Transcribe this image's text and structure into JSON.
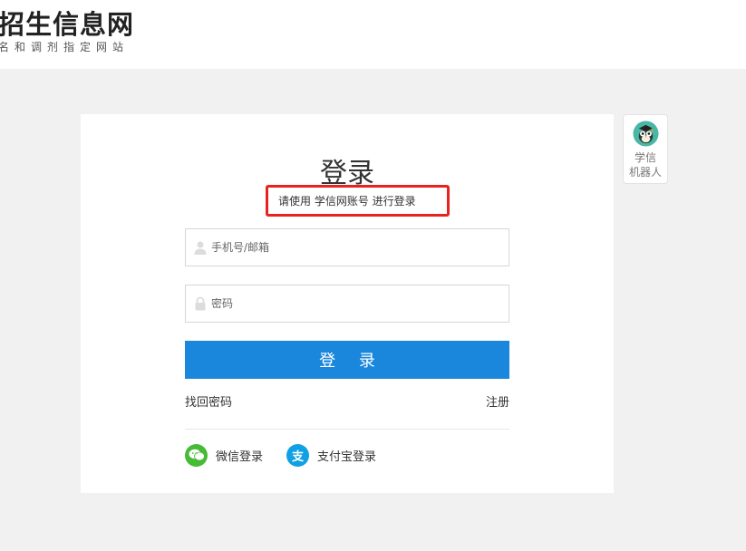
{
  "header": {
    "site_title": "招生信息网",
    "site_subtitle": "名和调剂指定网站"
  },
  "login": {
    "title": "登录",
    "hint": "请使用 学信网账号 进行登录",
    "phone_placeholder": "手机号/邮箱",
    "password_placeholder": "密码",
    "submit_label": "登 录",
    "forgot_label": "找回密码",
    "register_label": "注册"
  },
  "social": {
    "wechat_label": "微信登录",
    "alipay_label": "支付宝登录",
    "alipay_glyph": "支"
  },
  "robot": {
    "line1": "学信",
    "line2": "机器人"
  },
  "colors": {
    "primary": "#1a87dc",
    "highlight": "#e8231f",
    "wechat": "#46bb36",
    "alipay": "#11a0e3"
  },
  "icons": [
    "user-icon",
    "lock-icon",
    "wechat-icon",
    "alipay-icon",
    "robot-avatar-icon"
  ]
}
